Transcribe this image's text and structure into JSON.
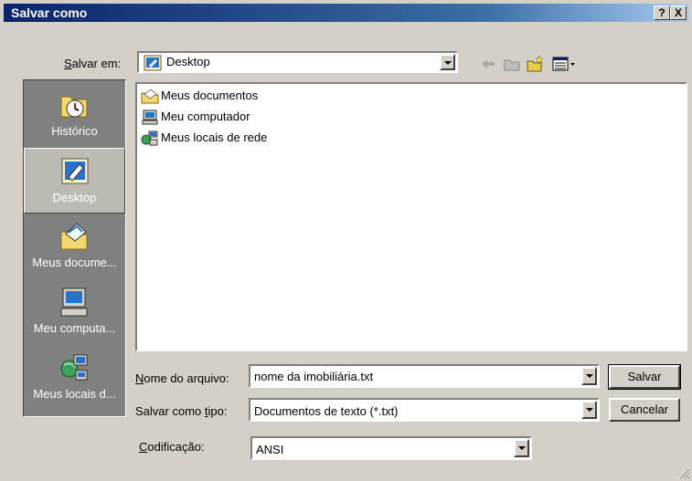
{
  "window": {
    "title": "Salvar como",
    "help_label": "?",
    "close_label": "X"
  },
  "save_in": {
    "label": "Salvar em:",
    "value": "Desktop"
  },
  "places": [
    {
      "label": "Histórico",
      "icon": "history-icon"
    },
    {
      "label": "Desktop",
      "icon": "desktop-icon"
    },
    {
      "label": "Meus docume...",
      "icon": "my-documents-icon"
    },
    {
      "label": "Meu computa...",
      "icon": "my-computer-icon"
    },
    {
      "label": "Meus locais d...",
      "icon": "network-places-icon"
    }
  ],
  "files": [
    {
      "name": "Meus documentos",
      "icon": "folder-documents-icon"
    },
    {
      "name": "Meu computador",
      "icon": "computer-icon"
    },
    {
      "name": "Meus locais de rede",
      "icon": "network-icon"
    }
  ],
  "filename": {
    "label": "Nome do arquivo:",
    "value": "nome da imobiliária.txt"
  },
  "filetype": {
    "label": "Salvar como tipo:",
    "value": "Documentos de texto (*.txt)"
  },
  "encoding": {
    "label": "Codificação:",
    "value": "ANSI"
  },
  "buttons": {
    "save": "Salvar",
    "cancel": "Cancelar"
  },
  "colors": {
    "titlebar": "#0a246a",
    "face": "#d4d0c8",
    "places_bg": "#808080"
  }
}
